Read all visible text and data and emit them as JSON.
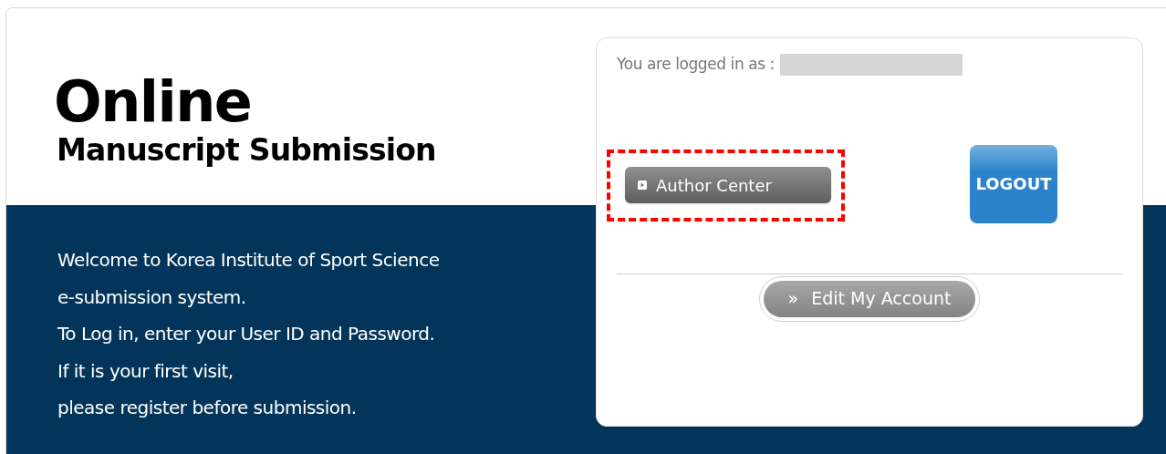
{
  "header": {
    "title": "Online",
    "subtitle": "Manuscript Submission"
  },
  "welcome": {
    "lines": [
      "Welcome to Korea Institute of Sport Science",
      "e-submission system.",
      "To Log in, enter your User ID and Password.",
      "If it is your first visit,",
      "please register before submission."
    ]
  },
  "account_panel": {
    "logged_in_label": "You are logged in as :",
    "author_center": {
      "label": "Author Center",
      "highlighted": true
    },
    "logout": {
      "label": "LOGOUT"
    },
    "edit_account": {
      "icon": "»",
      "label": "Edit My Account"
    }
  }
}
